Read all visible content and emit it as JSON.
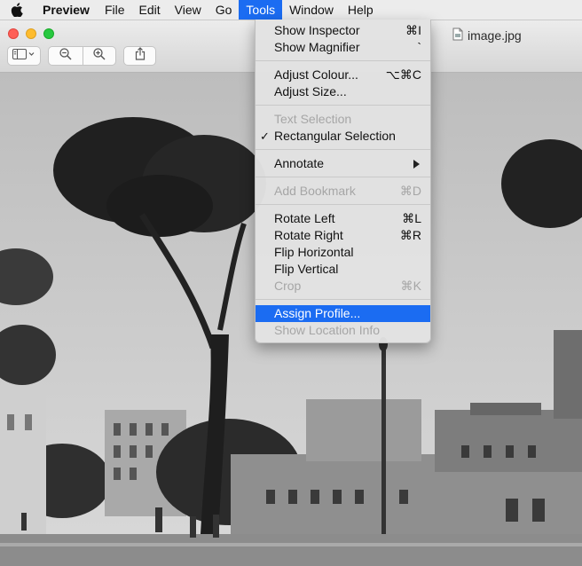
{
  "menubar": {
    "apple_icon": "apple-logo-icon",
    "app_name": "Preview",
    "items": [
      "File",
      "Edit",
      "View",
      "Go",
      "Tools",
      "Window",
      "Help"
    ],
    "active": "Tools"
  },
  "window": {
    "title": "image.jpg",
    "file_icon": "document-icon",
    "toolbar_icons": [
      "sidebar-toggle-icon",
      "zoom-out-icon",
      "zoom-in-icon",
      "share-icon"
    ]
  },
  "tools_menu": {
    "items": [
      {
        "label": "Show Inspector",
        "shortcut": "⌘I",
        "enabled": true
      },
      {
        "label": "Show Magnifier",
        "shortcut": "`",
        "enabled": true
      },
      {
        "label": "Adjust Colour...",
        "shortcut": "⌥⌘C",
        "enabled": true
      },
      {
        "label": "Adjust Size...",
        "shortcut": "",
        "enabled": true
      },
      {
        "label": "Text Selection",
        "shortcut": "",
        "enabled": false
      },
      {
        "label": "Rectangular Selection",
        "shortcut": "",
        "enabled": true,
        "checked": true
      },
      {
        "label": "Annotate",
        "shortcut": "",
        "enabled": true,
        "submenu": true
      },
      {
        "label": "Add Bookmark",
        "shortcut": "⌘D",
        "enabled": false
      },
      {
        "label": "Rotate Left",
        "shortcut": "⌘L",
        "enabled": true
      },
      {
        "label": "Rotate Right",
        "shortcut": "⌘R",
        "enabled": true
      },
      {
        "label": "Flip Horizontal",
        "shortcut": "",
        "enabled": true
      },
      {
        "label": "Flip Vertical",
        "shortcut": "",
        "enabled": true
      },
      {
        "label": "Crop",
        "shortcut": "⌘K",
        "enabled": false
      },
      {
        "label": "Assign Profile...",
        "shortcut": "",
        "enabled": true,
        "highlighted": true
      },
      {
        "label": "Show Location Info",
        "shortcut": "",
        "enabled": false
      }
    ],
    "check_glyph": "✓"
  },
  "colors": {
    "highlight": "#1b6cf2",
    "close": "#fe5f57",
    "minimize": "#febc2e",
    "maximize": "#28c840"
  }
}
